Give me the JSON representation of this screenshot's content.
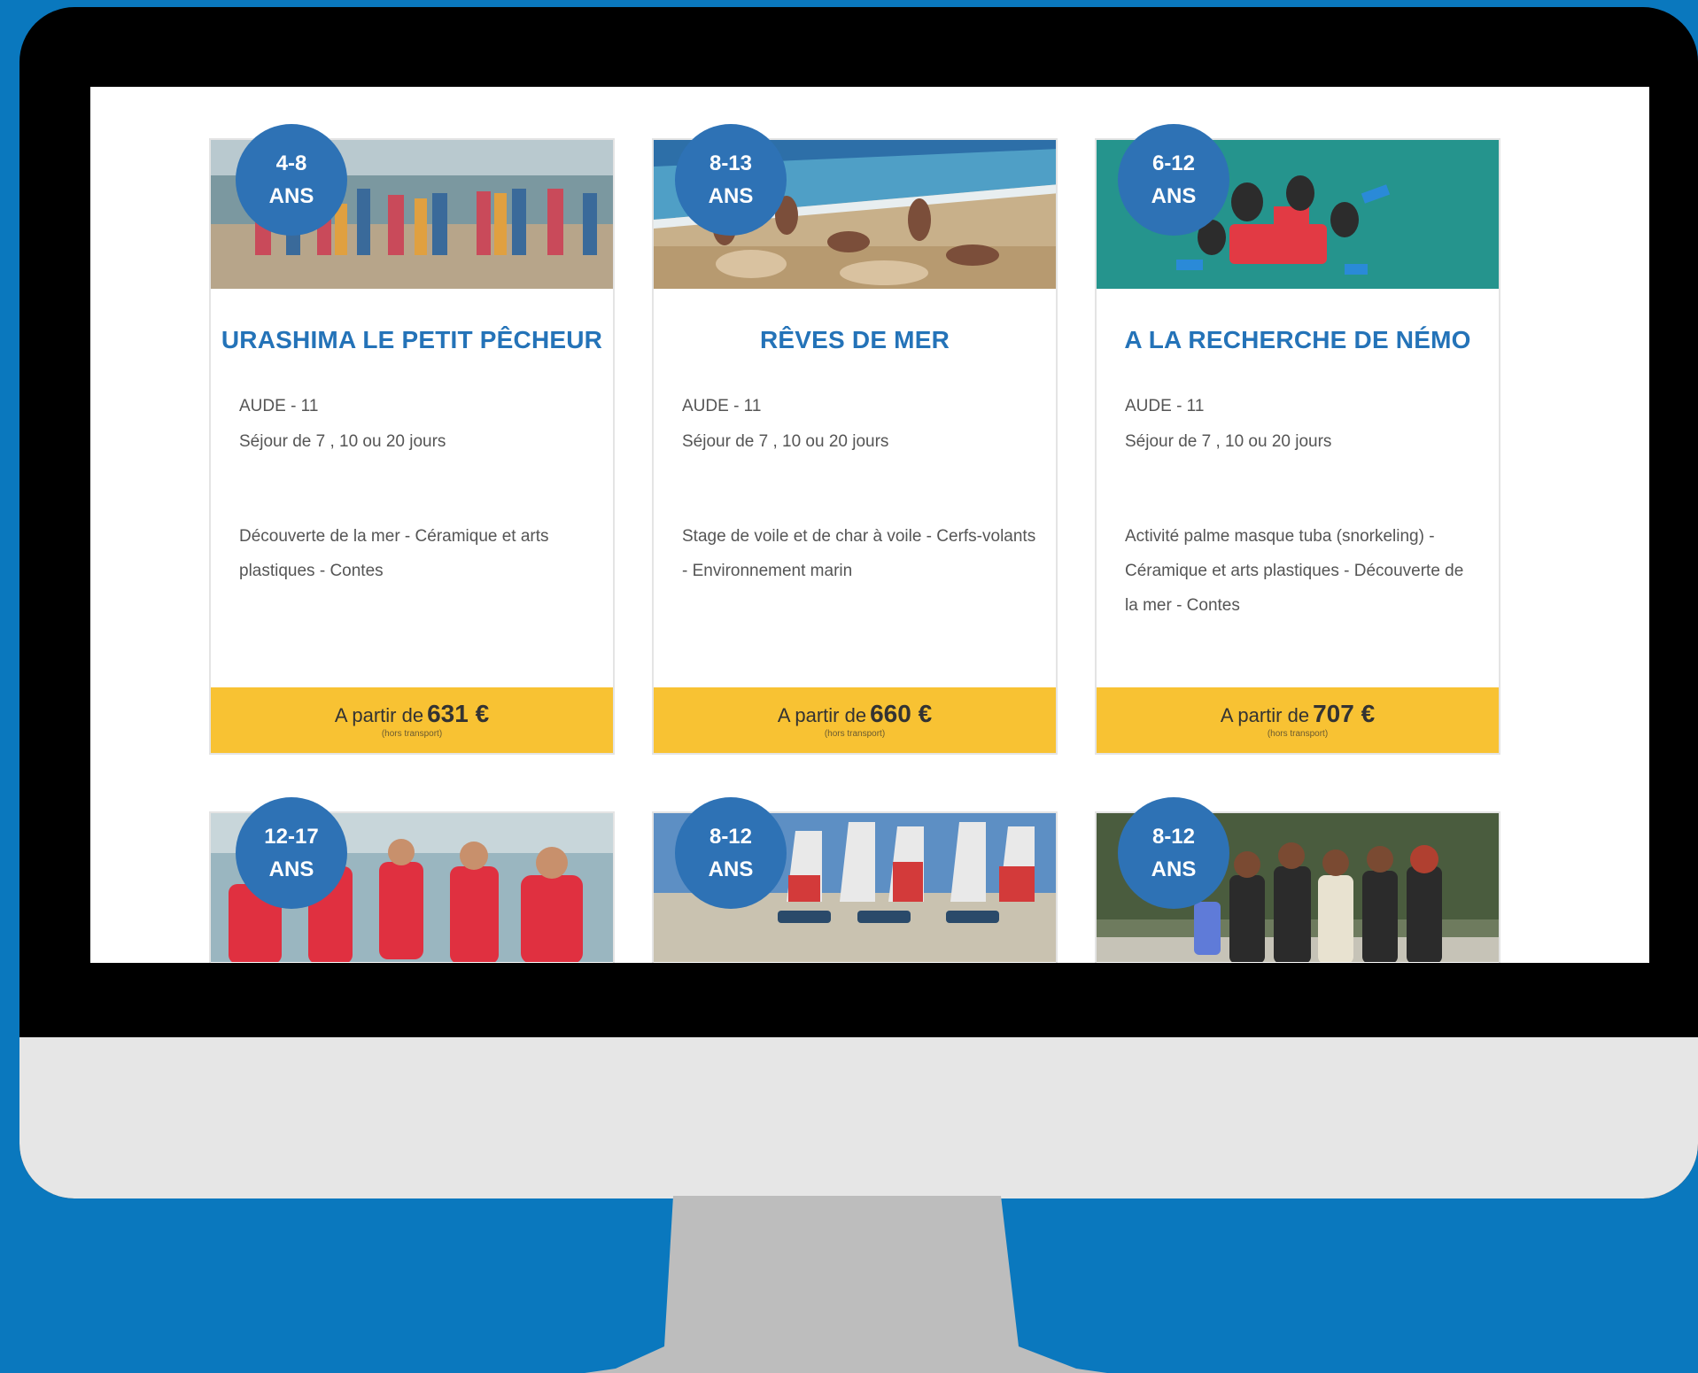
{
  "cards": [
    {
      "age_line1": "4-8",
      "age_line2": "ANS",
      "title": "URASHIMA LE PETIT PÊCHEUR",
      "location": "AUDE - 11",
      "duration": "Séjour de 7 , 10 ou 20 jours",
      "activities": "Découverte de la mer - Céramique et arts plastiques - Contes",
      "price_prefix": "A partir de",
      "price": "631 €",
      "price_note": "(hors transport)"
    },
    {
      "age_line1": "8-13",
      "age_line2": "ANS",
      "title": "RÊVES DE MER",
      "location": "AUDE - 11",
      "duration": "Séjour de 7 , 10 ou 20 jours",
      "activities": "Stage de voile et de char à voile - Cerfs-volants - Environnement marin",
      "price_prefix": "A partir de",
      "price": "660 €",
      "price_note": "(hors transport)"
    },
    {
      "age_line1": "6-12",
      "age_line2": "ANS",
      "title": "A LA RECHERCHE DE NÉMO",
      "location": "AUDE - 11",
      "duration": "Séjour de 7 , 10 ou 20 jours",
      "activities": "Activité palme masque tuba (snorkeling) - Céramique et arts plastiques - Découverte de la mer - Contes",
      "price_prefix": "A partir de",
      "price": "707 €",
      "price_note": "(hors transport)"
    },
    {
      "age_line1": "12-17",
      "age_line2": "ANS"
    },
    {
      "age_line1": "8-12",
      "age_line2": "ANS"
    },
    {
      "age_line1": "8-12",
      "age_line2": "ANS"
    }
  ],
  "colors": {
    "background": "#0a78be",
    "badge": "#2e72b5",
    "title": "#2473b8",
    "price_bar": "#f8c233"
  }
}
